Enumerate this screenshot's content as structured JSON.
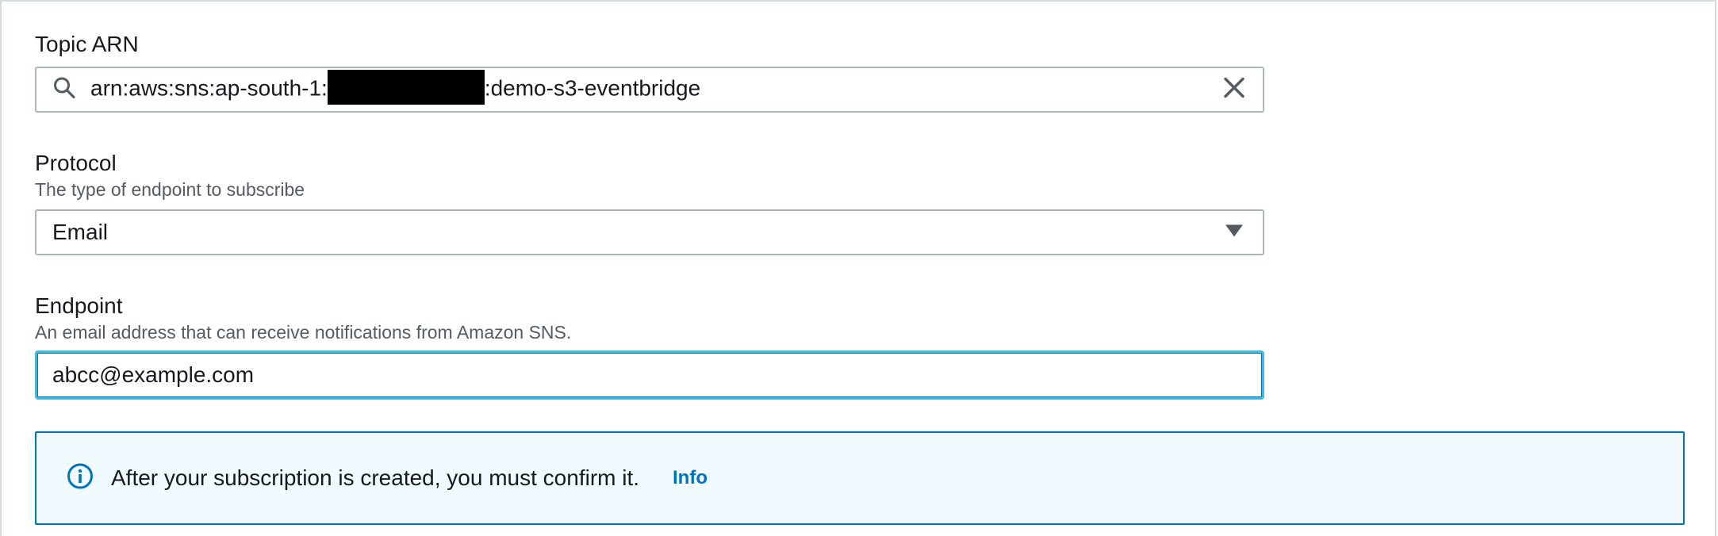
{
  "topic_arn": {
    "label": "Topic ARN",
    "value_prefix": "arn:aws:sns:ap-south-1:",
    "value_suffix": ":demo-s3-eventbridge"
  },
  "protocol": {
    "label": "Protocol",
    "description": "The type of endpoint to subscribe",
    "selected": "Email"
  },
  "endpoint": {
    "label": "Endpoint",
    "description": "An email address that can receive notifications from Amazon SNS.",
    "value": "abcc@example.com"
  },
  "alert": {
    "message": "After your subscription is created, you must confirm it.",
    "link_label": "Info"
  },
  "icons": {
    "search": "search-icon",
    "clear": "close-icon",
    "dropdown": "caret-down-icon",
    "info": "info-icon"
  },
  "colors": {
    "text": "#16191f",
    "secondary_text": "#545b64",
    "border": "#aab7b8",
    "focus_border": "#44b9d6",
    "info_blue": "#0073bb",
    "alert_background": "#f1faff"
  }
}
